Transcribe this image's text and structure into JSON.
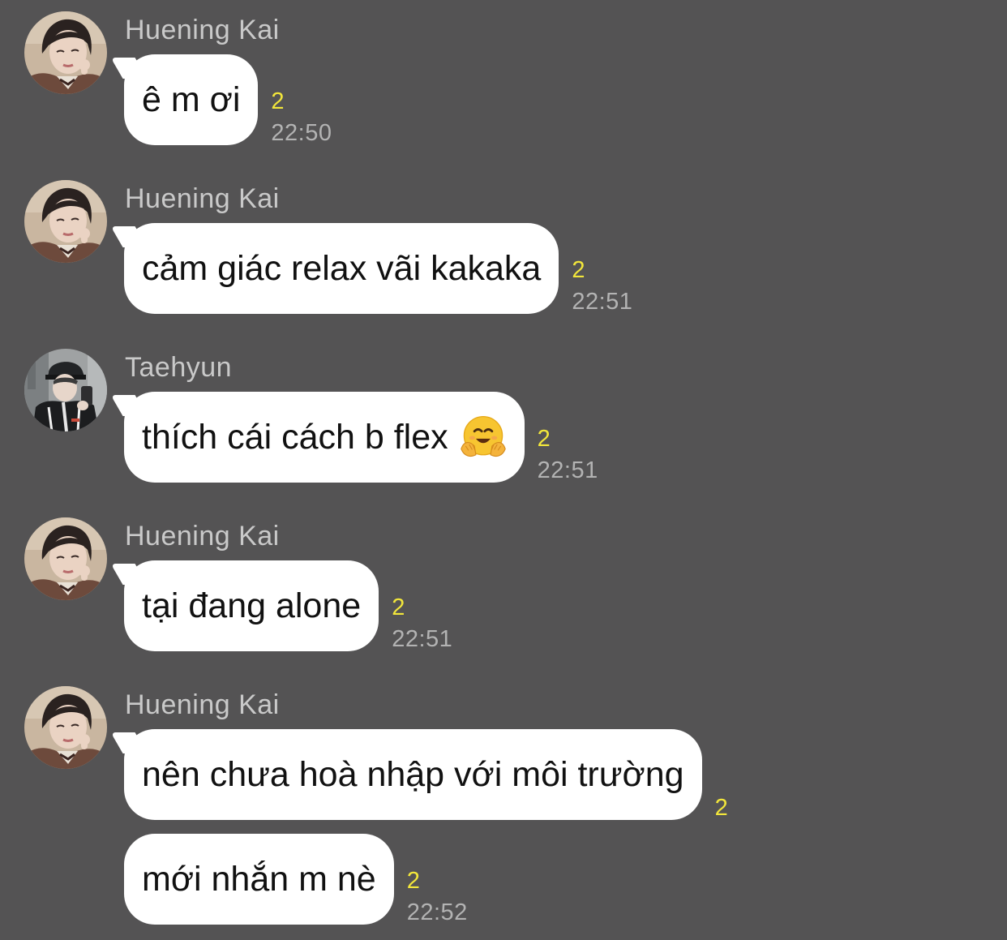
{
  "colors": {
    "background": "#545354",
    "bubble": "#ffffff",
    "sender": "#c9c9c9",
    "unread": "#f2e63b",
    "time": "#b3b3b3"
  },
  "messages": [
    {
      "sender": "Huening Kai",
      "avatar": "avatar-huening-kai",
      "text": "ê m ơi",
      "unread": "2",
      "time": "22:50"
    },
    {
      "sender": "Huening Kai",
      "avatar": "avatar-huening-kai",
      "text": "cảm giác relax vãi kakaka",
      "unread": "2",
      "time": "22:51"
    },
    {
      "sender": "Taehyun",
      "avatar": "avatar-taehyun",
      "text": "thích cái cách b flex",
      "emoji": "hugging-face-emoji",
      "unread": "2",
      "time": "22:51"
    },
    {
      "sender": "Huening Kai",
      "avatar": "avatar-huening-kai",
      "text": "tại đang alone",
      "unread": "2",
      "time": "22:51"
    },
    {
      "sender": "Huening Kai",
      "avatar": "avatar-huening-kai",
      "text": "nên chưa hoà nhập với môi trường",
      "unread": "2",
      "time": ""
    },
    {
      "sender": "",
      "avatar": "",
      "text": "mới nhắn m nè",
      "unread": "2",
      "time": "22:52"
    }
  ]
}
